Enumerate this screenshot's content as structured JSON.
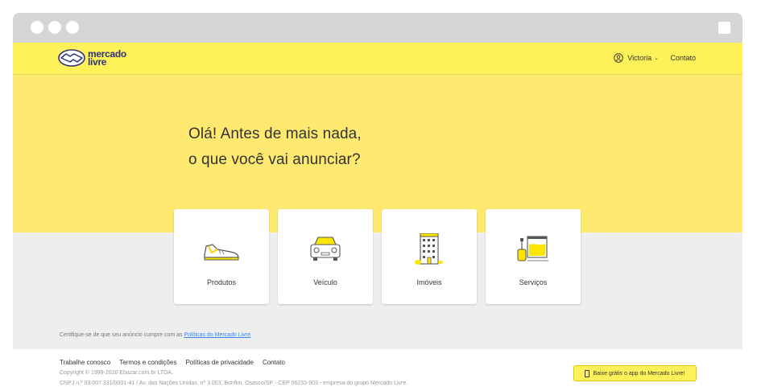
{
  "window": {
    "title": ""
  },
  "header": {
    "logo": {
      "line1": "mercado",
      "line2": "livre"
    },
    "user_name": "Victoria",
    "contact": "Contato"
  },
  "hero": {
    "line1": "Olá! Antes de mais nada,",
    "line2": "o que você vai anunciar?"
  },
  "categories": [
    {
      "label": "Produtos",
      "icon": "sneaker-icon"
    },
    {
      "label": "Veículo",
      "icon": "car-icon"
    },
    {
      "label": "Imóveis",
      "icon": "building-icon"
    },
    {
      "label": "Serviços",
      "icon": "paint-bucket-icon"
    }
  ],
  "notice": {
    "text": "Certifique-se de que seu anúncio cumpre com as ",
    "link": "Políticas do Mercado Livre"
  },
  "footer": {
    "links": [
      "Trabalhe conosco",
      "Termos e condições",
      "Políticas de privacidade",
      "Contato"
    ],
    "copyright": "Copyright © 1999-2020 Ebazar.com.br LTDA.",
    "address": "CNPJ n.º 03.007.331/0001-41 / Av. das Nações Unidas, nº 3.003, Bonfim, Osasco/SP - CEP 06233-903 - empresa do grupo Mercado Livre.",
    "app_button": "Baixe grátis o app do Mercado Livre!"
  },
  "colors": {
    "brand_yellow": "#fff159",
    "hero_yellow": "#ffe970",
    "brand_blue": "#2d3277",
    "link_blue": "#3483fa"
  }
}
